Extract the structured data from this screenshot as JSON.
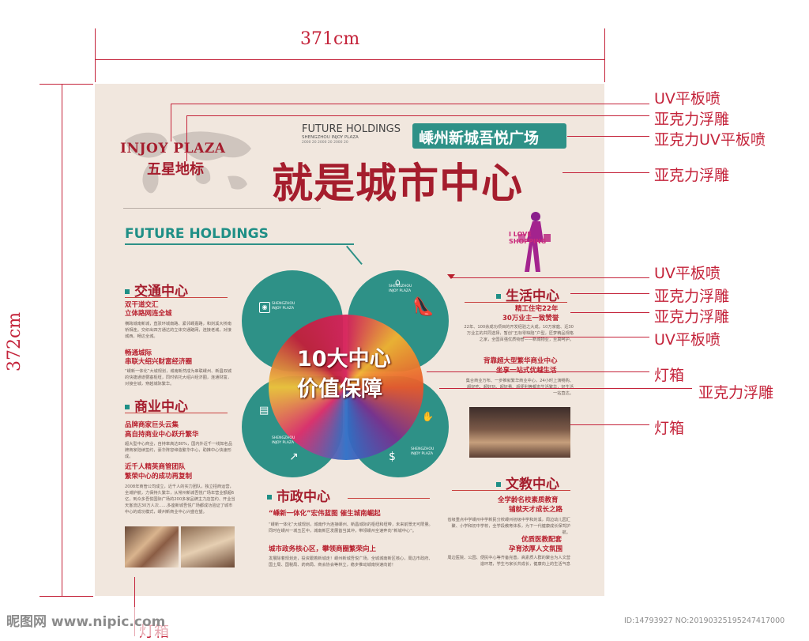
{
  "dimensions": {
    "width_label": "371cm",
    "height_label": "372cm"
  },
  "header": {
    "logo_en": "INJOY PLAZA",
    "logo_cn": "五星地标",
    "future_title": "FUTURE HOLDINGS",
    "future_sub": "SHENGZHOU INJOY PLAZA",
    "future_years": "2000 20   2000 20   2000 20",
    "badge": "嵊州新城吾悦广场",
    "headline": "就是城市中心",
    "future_holdings_green": "FUTURE HOLDINGS",
    "love_shopping": "I LOVE SHOPPING"
  },
  "center": {
    "line1": "10大中心",
    "line2": "价值保障",
    "leaf_label": "SHENGZHOU INJOY PLAZA"
  },
  "sections": {
    "traffic": {
      "title": "交通中心",
      "h1a": "双干道交汇",
      "h1b": "立体路网连全城",
      "p1": "横跨城南新城，直驳环城南路、紧邻嵊嘉路，和剡溪大桥南桥相连。交织出四方通达的立体交通路网，连接老城，对接城西，畅达全城。",
      "h2a": "畅通城际",
      "h2b": "串联大绍兴财富经济圈",
      "p2": "“嵊新一体化”大城规划，城南新然成为串联嵊州、新昌双城的快捷通道要塞枢纽，同时依托大绍兴经济圈，连通财富，对接全城，穿越城际繁华。"
    },
    "business": {
      "title": "商业中心",
      "h1a": "品牌商家巨头云集",
      "h1b": "高自持商业中心跃升繁华",
      "p1": "超大型中心商业，自持率高达80%，国内外近千一线知名品牌商家陆续签约，豪华阵容缔造繁华中心，助推中心快速形成。",
      "h2a": "近千人精英商管团队",
      "h2b": "繁荣中心的成功再复制",
      "p2": "2008年商管公司成立，近千人的实力团队，独立招商运营，全城护航，力保持久繁华，从常州新城吾悦广场年营业额超6亿，到众多吾悦国际广场的200多家品牌主力店签约、开业当天客流达30万人次……多座新城吾悦广场都成功验证了城市中心的成功模式，嵊州新商业中心兴盛在望。"
    },
    "civic": {
      "title": "市政中心",
      "h1": "“嵊新一体化”宏伟蓝图  催生城南崛起",
      "p1": "“嵊新一体化”大城规划，城南作为连接嵊州、新昌城际的枢纽和纽带，未来前景无可限量。同时在嵊州一城五区中，城南新区发展首当其冲，带领嵊州全速奔向“新城中心”。",
      "h2": "城市政务核心区，攀领商圈繁荣向上",
      "p2": "发展除着规划走，投资跟着新城走！嵊州新城吾悦广场，全城城南新区核心，周边市政府、国土局、国税局、药商局、商会协会等林立，稳步推动城南快速向前！"
    },
    "life": {
      "title": "生活中心",
      "h1a": "精工住宅22年",
      "h1b": "30万业主一致赞誉",
      "p1": "22年、100余成功项目的开发经验之大成，10万家庭、近30万业主的共同选择，暂创“五标零缺陷”户型，匠梦精品规格之家，全国百强优质物管——新城物业，至真呵护。",
      "h2a": "背靠超大型繁华商业中心",
      "h2b": "坐享一站式优越生活",
      "p2": "集合商业万布、一步推就繁华商业中心，24小时上演畅购、超好吃、超好玩、超好看、超便利等都市生活繁华，好生活一站直达。"
    },
    "culture": {
      "title": "文教中心",
      "h1a": "全学龄名校素质教育",
      "h1b": "铺就天才成长之路",
      "p1": "省级重点中学嵊州中学新民分校嵊州初级中学和剡溪，周边幼儿园汇聚、小学和初中学校，全学段教育体系，为下一代健康成长保驾护航。",
      "h2a": "优质医教配套",
      "h2b": "孕育浓厚人文氛围",
      "p2": "周边医院、公园、便民中心等齐备完善，高素质人群的聚合为人文营造环境，学生与家长共成长，健康向上的生活气息"
    }
  },
  "right_labels": [
    {
      "text": "UV平板喷"
    },
    {
      "text": "亚克力浮雕"
    },
    {
      "text": "亚克力UV平板喷"
    },
    {
      "text": "亚克力浮雕"
    },
    {
      "text": "UV平板喷"
    },
    {
      "text": "亚克力浮雕"
    },
    {
      "text": "亚克力浮雕"
    },
    {
      "text": "UV平板喷"
    },
    {
      "text": "灯箱"
    },
    {
      "text": "亚克力浮雕"
    },
    {
      "text": "灯箱"
    }
  ],
  "bottom_label": "灯箱",
  "watermark": {
    "left": "昵图网 www.nipic.com",
    "right": "ID:14793927 NO:20190325195247417000"
  },
  "colors": {
    "red": "#b81f2d",
    "green": "#2e9187",
    "board": "#f1e7de",
    "label_red": "#c4233a"
  }
}
